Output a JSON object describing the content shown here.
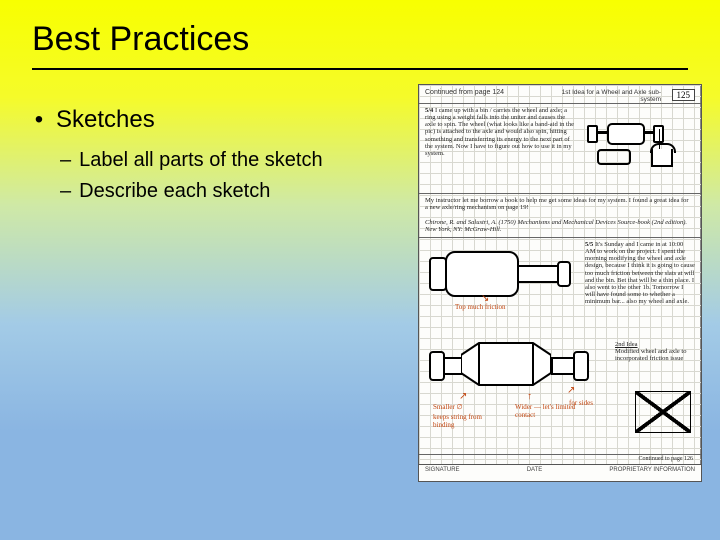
{
  "title": "Best Practices",
  "bullets": {
    "main": "Sketches",
    "sub1": "Label all parts of the sketch",
    "sub2": "Describe each sketch"
  },
  "notebook": {
    "page_number": "125",
    "header_left": "Continued from page 124",
    "header_right": "1st Idea for a Wheel and Axle sub-system",
    "entry1_label": "5/4",
    "entry1": "I came up with a bin / carries the wheel and axle; a ring using a weight falls into the uniter and causes the axle to spin. The wheel (what looks like a band-aid in the pic) is attached to the axle and would also spin, hitting something and transferring its energy to the next part of the system. Now I have to figure out how to use it in my system.",
    "entry2": "My instructor let me borrow a book to help me get some ideas for my system. I found a great idea for a new axle/ring mechanism on page 19!",
    "citation": "Chirone, R. and Salustri, A. (1750) Mechanisms and Mechanical Devices Source-book (2nd edition). New York, NY: McGraw-Hill.",
    "entry3_label": "5/5",
    "entry3": "It's Sunday and I came in at 10:00 AM to work on the project. I spent the morning modifying the wheel and axle design, because I think it is going to cause too much friction between the slats at will and the bin. Bet that will be a thin place. I also went to the other 1b. Tomorrow I will have found some to whether a minimum bar... also my wheel and axle.",
    "side_note_title": "2nd Idea",
    "side_note": "Modified wheel and axle to incorporated friction issue",
    "label_top": "Top much friction",
    "label_smaller": "Smaller ∅",
    "label_keeps": "keeps string from binding",
    "label_wider": "Wider — let's limited contact",
    "label_sides": "for sides",
    "footer_continued": "Continued to page 126",
    "footer_proprietary": "PROPRIETARY INFORMATION",
    "footer_signed": "SIGNATURE",
    "footer_date": "DATE"
  }
}
